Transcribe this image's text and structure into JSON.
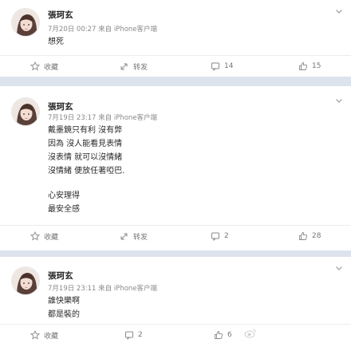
{
  "posts": [
    {
      "user": "張珂玄",
      "meta": "7月20日 00:27 来自 iPhone客户端",
      "lines": [
        "想死"
      ],
      "actions": {
        "favorite": "收藏",
        "repost": "转发",
        "comments": "14",
        "likes": "15"
      }
    },
    {
      "user": "張珂玄",
      "meta": "7月19日 23:17 来自 iPhone客户端",
      "lines": [
        "戴墨鏡只有利 沒有弊",
        "因為 沒人能看見表情",
        "沒表情 就可以沒情緒",
        "沒情緒 便放任著啞巴.",
        "",
        "心安理得",
        "最安全感"
      ],
      "actions": {
        "favorite": "收藏",
        "repost": "转发",
        "comments": "2",
        "likes": "28"
      }
    },
    {
      "user": "張珂玄",
      "meta": "7月19日 23:11 来自 iPhone客户端",
      "lines": [
        "誰快樂啊",
        "都是裝的"
      ],
      "actions": {
        "favorite": "收藏",
        "repost": "",
        "comments": "2",
        "likes": "6"
      }
    }
  ],
  "colors": {
    "separator": "#dde3ec",
    "text": "#2a2a2a",
    "meta": "#8a8a8a",
    "action": "#777777"
  },
  "icons": {
    "favorite": "star-outline-icon",
    "repost": "repost-arrow-icon",
    "comment": "comment-bubble-icon",
    "like": "thumbs-up-icon",
    "more": "chevron-down-icon",
    "watermark": "weibo-logo-icon"
  }
}
